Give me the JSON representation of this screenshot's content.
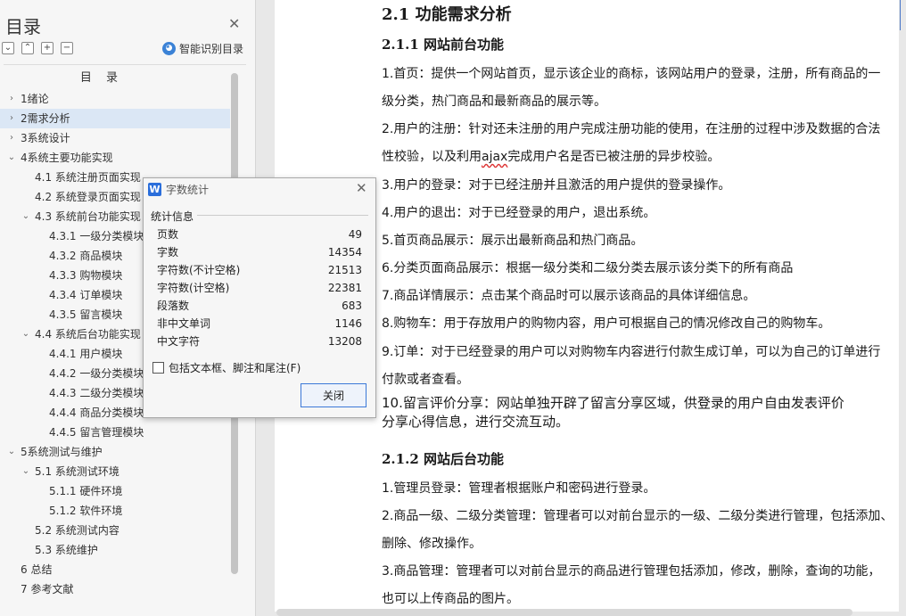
{
  "sidebar": {
    "title": "目录",
    "smart_toc_label": "智能识别目录",
    "toc_heading": "目  录",
    "items": [
      {
        "label": "1绪论",
        "level": 0,
        "expand": "collapsed"
      },
      {
        "label": "2需求分析",
        "level": 0,
        "expand": "collapsed",
        "selected": true
      },
      {
        "label": "3系统设计",
        "level": 0,
        "expand": "collapsed"
      },
      {
        "label": "4系统主要功能实现",
        "level": 0,
        "expand": "expanded"
      },
      {
        "label": "4.1  系统注册页面实现",
        "level": 1,
        "expand": "none"
      },
      {
        "label": "4.2  系统登录页面实现",
        "level": 1,
        "expand": "none"
      },
      {
        "label": "4.3 系统前台功能实现",
        "level": 1,
        "expand": "expanded"
      },
      {
        "label": "4.3.1 一级分类模块",
        "level": 2,
        "expand": "none"
      },
      {
        "label": "4.3.2 商品模块",
        "level": 2,
        "expand": "none"
      },
      {
        "label": "4.3.3 购物模块",
        "level": 2,
        "expand": "none"
      },
      {
        "label": "4.3.4 订单模块",
        "level": 2,
        "expand": "none"
      },
      {
        "label": "4.3.5 留言模块",
        "level": 2,
        "expand": "none"
      },
      {
        "label": "4.4 系统后台功能实现",
        "level": 1,
        "expand": "expanded"
      },
      {
        "label": "4.4.1 用户模块",
        "level": 2,
        "expand": "none"
      },
      {
        "label": "4.4.2 一级分类模块",
        "level": 2,
        "expand": "none"
      },
      {
        "label": "4.4.3 二级分类模块",
        "level": 2,
        "expand": "none"
      },
      {
        "label": "4.4.4 商品分类模块",
        "level": 2,
        "expand": "none"
      },
      {
        "label": "4.4.5 留言管理模块",
        "level": 2,
        "expand": "none"
      },
      {
        "label": "5系统测试与维护",
        "level": 0,
        "expand": "expanded"
      },
      {
        "label": "5.1 系统测试环境",
        "level": 1,
        "expand": "expanded"
      },
      {
        "label": "5.1.1 硬件环境",
        "level": 2,
        "expand": "none"
      },
      {
        "label": "5.1.2 软件环境",
        "level": 2,
        "expand": "none"
      },
      {
        "label": "5.2 系统测试内容",
        "level": 1,
        "expand": "none"
      },
      {
        "label": "5.3 系统维护",
        "level": 1,
        "expand": "none"
      },
      {
        "label": "6 总结",
        "level": 0,
        "expand": "none"
      },
      {
        "label": "7 参考文献",
        "level": 0,
        "expand": "none"
      }
    ]
  },
  "document": {
    "section_title": "2.1 功能需求分析",
    "sub1_title": "2.1.1 网站前台功能",
    "p1_line1": "1.首页：提供一个网站首页，显示该企业的商标，该网站用户的登录，注册，所有商品的一",
    "p1_line2": "级分类，热门商品和最新商品的展示等。",
    "p2_line1": "2.用户的注册：针对还未注册的用户完成注册功能的使用，在注册的过程中涉及数据的合法",
    "p2_line2_pre": "性校验，以及利用",
    "p2_line2_wavy": "ajax",
    "p2_line2_post": "完成用户名是否已被注册的异步校验。",
    "p3": "3.用户的登录：对于已经注册并且激活的用户提供的登录操作。",
    "p4": "4.用户的退出：对于已经登录的用户，退出系统。",
    "p5": "5.首页商品展示：展示出最新商品和热门商品。",
    "p6": "6.分类页面商品展示：根据一级分类和二级分类去展示该分类下的所有商品",
    "p7": "7.商品详情展示：点击某个商品时可以展示该商品的具体详细信息。",
    "p8": "8.购物车：用于存放用户的购物内容，用户可根据自己的情况修改自己的购物车。",
    "p9_line1": "9.订单：对于已经登录的用户可以对购物车内容进行付款生成订单，可以为自己的订单进行",
    "p9_line2": "付款或者查看。",
    "p10_line1": "10.留言评价分享：网站单独开辟了留言分享区域，供登录的用户自由发表评价",
    "p10_line2": "分享心得信息，进行交流互动。",
    "sub2_title": "2.1.2 网站后台功能",
    "b1": "1.管理员登录：管理者根据账户和密码进行登录。",
    "b2_line1": "2.商品一级、二级分类管理：管理者可以对前台显示的一级、二级分类进行管理，包括添加、",
    "b2_line2": "删除、修改操作。",
    "b3_line1": "3.商品管理：管理者可以对前台显示的商品进行管理包括添加，修改，删除，查询的功能，",
    "b3_line2": "也可以上传商品的图片。"
  },
  "dialog": {
    "icon_letter": "W",
    "title": "字数统计",
    "group_label": "统计信息",
    "stats": [
      {
        "label": "页数",
        "value": "49"
      },
      {
        "label": "字数",
        "value": "14354"
      },
      {
        "label": "字符数(不计空格)",
        "value": "21513"
      },
      {
        "label": "字符数(计空格)",
        "value": "22381"
      },
      {
        "label": "段落数",
        "value": "683"
      },
      {
        "label": "非中文单词",
        "value": "1146"
      },
      {
        "label": "中文字符",
        "value": "13208"
      }
    ],
    "checkbox_label": "包括文本框、脚注和尾注(F)",
    "checkbox_checked": false,
    "close_button": "关闭"
  },
  "colors": {
    "accent": "#3b78d8",
    "selected_row": "#dbe7f5",
    "spell_error": "#dd3333"
  }
}
